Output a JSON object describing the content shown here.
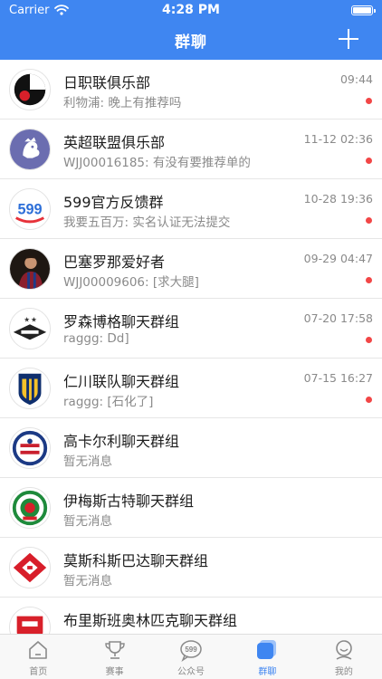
{
  "status_bar": {
    "carrier": "Carrier",
    "time": "4:28 PM"
  },
  "nav": {
    "title": "群聊",
    "add_icon": "plus-icon"
  },
  "colors": {
    "brand": "#3f86f1",
    "unread_dot": "#f24646"
  },
  "chats": [
    {
      "name": "日职联俱乐部",
      "message": "利物浦: 晚上有推荐吗",
      "time": "09:44",
      "unread": true,
      "avatar": "jleague-logo"
    },
    {
      "name": "英超联盟俱乐部",
      "message": "WJJ00016185: 有没有要推荐单的",
      "time": "11-12 02:36",
      "unread": true,
      "avatar": "premier-league-logo"
    },
    {
      "name": "599官方反馈群",
      "message": "我要五百万: 实名认证无法提交",
      "time": "10-28 19:36",
      "unread": true,
      "avatar": "599-logo",
      "avatar_text": "599"
    },
    {
      "name": "巴塞罗那爱好者",
      "message": "WJJ00009606: [求大腿]",
      "time": "09-29 04:47",
      "unread": true,
      "avatar": "player-photo"
    },
    {
      "name": "罗森博格聊天群组",
      "message": "raggg: Dd]",
      "time": "07-20 17:58",
      "unread": true,
      "avatar": "rosenborg-logo"
    },
    {
      "name": "仁川联队聊天群组",
      "message": "raggg: [石化了]",
      "time": "07-15 16:27",
      "unread": true,
      "avatar": "incheon-logo"
    },
    {
      "name": "高卡尔利聊天群组",
      "message": "暂无消息",
      "time": "",
      "unread": false,
      "avatar": "club-crest-logo"
    },
    {
      "name": "伊梅斯古特聊天群组",
      "message": "暂无消息",
      "time": "",
      "unread": false,
      "avatar": "green-club-logo"
    },
    {
      "name": "莫斯科斯巴达聊天群组",
      "message": "暂无消息",
      "time": "",
      "unread": false,
      "avatar": "spartak-logo"
    },
    {
      "name": "布里斯班奥林匹克聊天群组",
      "message": "",
      "time": "",
      "unread": false,
      "avatar": "red-club-logo"
    }
  ],
  "tabs": [
    {
      "label": "首页",
      "icon": "home-icon",
      "active": false
    },
    {
      "label": "赛事",
      "icon": "trophy-icon",
      "active": false
    },
    {
      "label": "公众号",
      "icon": "599-chat-icon",
      "icon_text": "599",
      "active": false
    },
    {
      "label": "群聊",
      "icon": "group-chat-icon",
      "active": true
    },
    {
      "label": "我的",
      "icon": "profile-icon",
      "active": false
    }
  ]
}
